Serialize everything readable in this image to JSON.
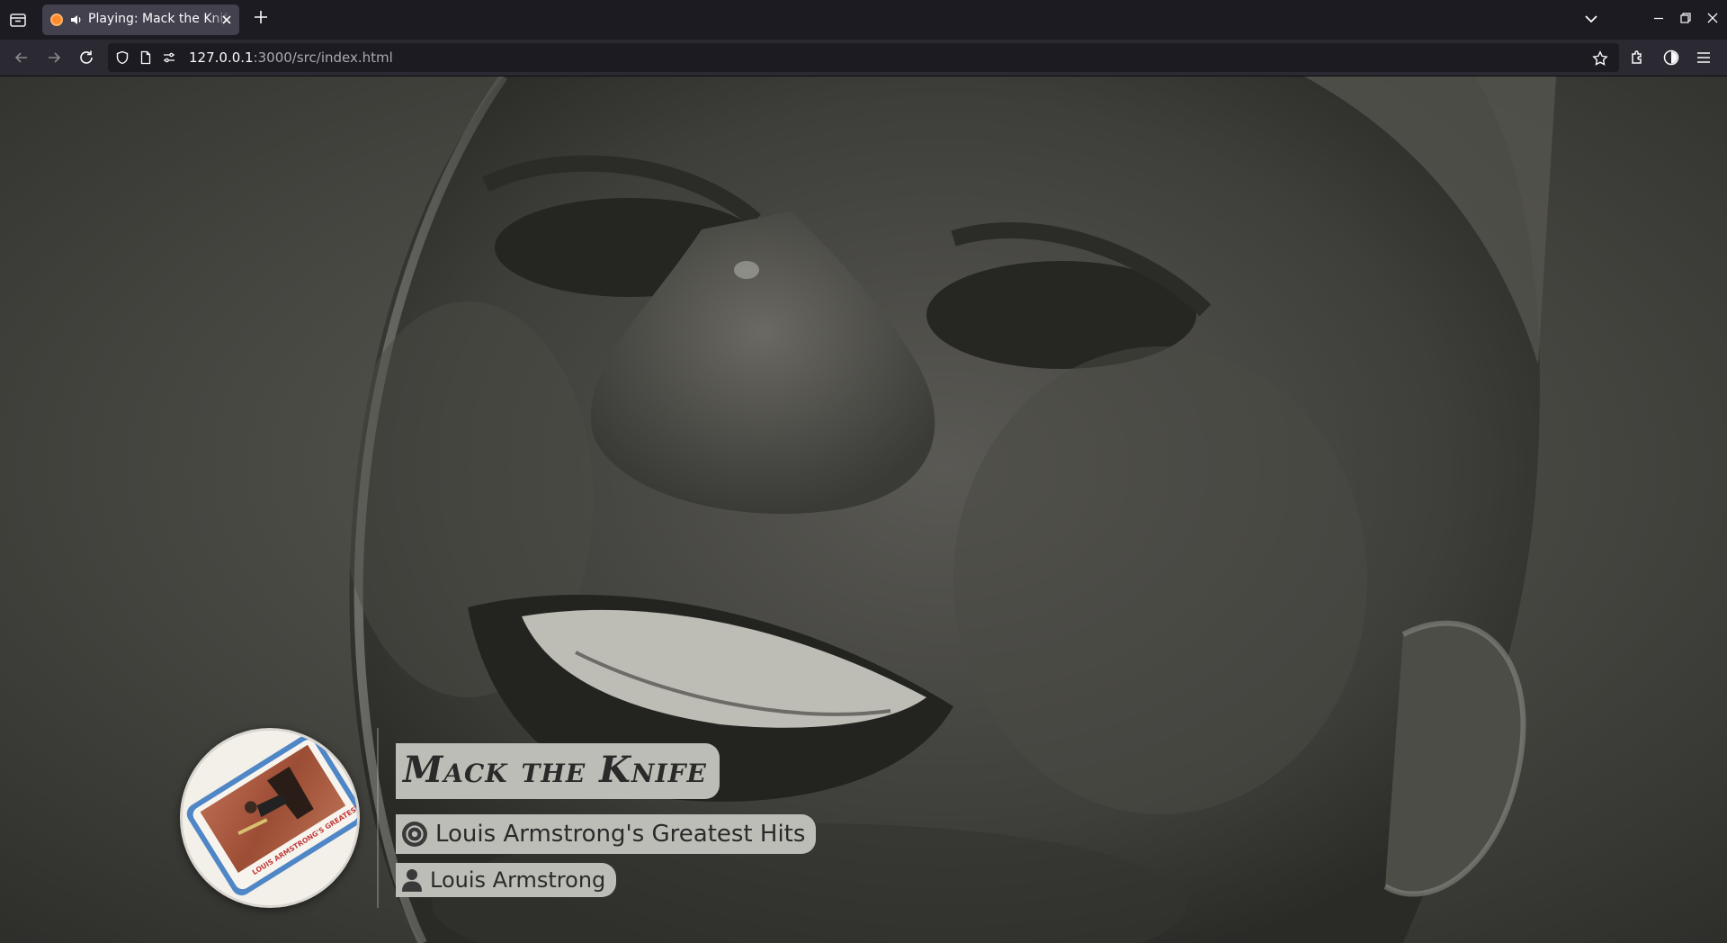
{
  "browser": {
    "tab": {
      "title": "Playing: Mack the Knife",
      "favicon": "media-favicon",
      "audio": "speaker-icon"
    },
    "url": {
      "host": "127.0.0.1",
      "rest": ":3000/src/index.html"
    },
    "icons": [
      "tab-list-icon",
      "close-icon",
      "plus-icon",
      "chevron-down-icon",
      "minimize-icon",
      "restore-icon",
      "window-close-icon",
      "back-arrow-icon",
      "forward-arrow-icon",
      "reload-icon",
      "shield-icon",
      "page-icon",
      "permissions-icon",
      "star-icon",
      "extensions-icon",
      "profile-icon",
      "hamburger-menu-icon"
    ]
  },
  "player": {
    "title": "Mack the Knife",
    "album": "Louis Armstrong's Greatest Hits",
    "artist": "Louis Armstrong",
    "album_icon": "disc-icon",
    "artist_icon": "person-icon",
    "cover_art": "Louis Armstrong's Greatest Hits album cover"
  },
  "colors": {
    "chip_bg": "#bdbdb7",
    "chip_text": "#2a2a2a",
    "tab_bg": "#42414d",
    "chrome_bg": "#1c1b22",
    "toolbar_bg": "#2b2a33"
  }
}
